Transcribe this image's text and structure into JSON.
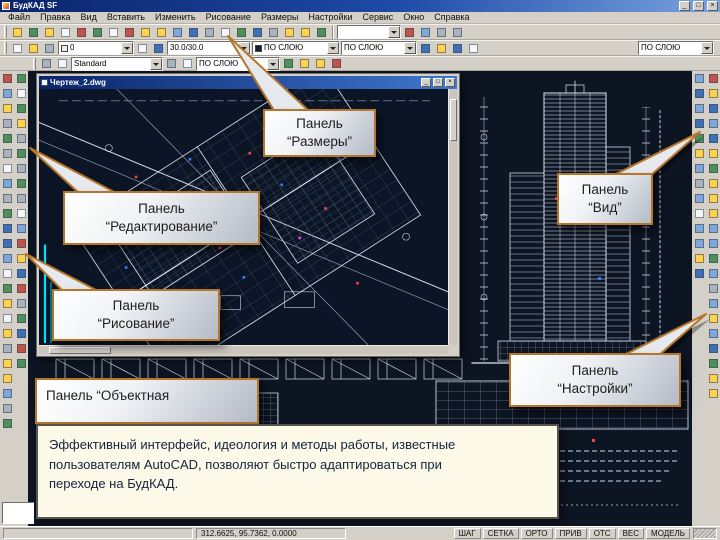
{
  "app": {
    "title": "БудКАД SF",
    "win_controls": {
      "min": "_",
      "max": "□",
      "close": "×"
    }
  },
  "menu": {
    "items": [
      {
        "label": "Файл",
        "name": "file"
      },
      {
        "label": "Правка",
        "name": "edit"
      },
      {
        "label": "Вид",
        "name": "view"
      },
      {
        "label": "Вставить",
        "name": "insert"
      },
      {
        "label": "Изменить",
        "name": "modify"
      },
      {
        "label": "Рисование",
        "name": "draw"
      },
      {
        "label": "Размеры",
        "name": "dimensions"
      },
      {
        "label": "Настройки",
        "name": "settings"
      },
      {
        "label": "Сервис",
        "name": "tools"
      },
      {
        "label": "Окно",
        "name": "window"
      },
      {
        "label": "Справка",
        "name": "help"
      }
    ]
  },
  "toolbars": {
    "row1_icons": [
      "new-file",
      "open-file",
      "save-file",
      "print",
      "print-preview",
      "spell-check",
      "cut",
      "copy",
      "paste",
      "match-properties",
      "undo",
      "redo",
      "insert-hyperlink",
      "ole-object",
      "pan-realtime",
      "zoom-realtime",
      "zoom-window",
      "zoom-previous",
      "properties",
      "help"
    ],
    "row1_combo": "",
    "row1_icons_b": [
      "redraw-view",
      "regen-view",
      "named-views",
      "3d-orbit"
    ],
    "row2_icons_a": [
      "layers-manager",
      "layer-states",
      "make-layer-current"
    ],
    "row2_icons_b": [
      "layer-previous",
      "layer-isolate"
    ],
    "row2_icons_c": [
      "linetype-manager",
      "lineweight-settings",
      "plot-style",
      "object-color"
    ],
    "row2_combos": [
      "0",
      "30.0/30.0",
      "ПО СЛОЮ",
      "ПО СЛОЮ"
    ],
    "row2_combo_right": "ПО СЛОЮ",
    "row3_icons_a": [
      "dim-linear",
      "dim-aligned"
    ],
    "row3_icons_b": [
      "dim-radius",
      "dim-angular"
    ],
    "row3_icons_c": [
      "dim-continue",
      "dim-baseline",
      "dim-style",
      "quick-dim"
    ],
    "row3_combos": [
      "Standard",
      "ПО СЛОЮ"
    ],
    "left_draw": [
      "line",
      "construction-line",
      "multiline",
      "polyline",
      "polygon",
      "rectangle",
      "arc",
      "circle",
      "revision-cloud",
      "spline",
      "ellipse",
      "ellipse-arc",
      "insert-block",
      "make-block",
      "point",
      "hatch",
      "gradient",
      "region",
      "table",
      "text-multiline",
      "text-single",
      "divide",
      "measure",
      "sketch"
    ],
    "left_modify": [
      "erase",
      "copy-object",
      "mirror",
      "offset",
      "array",
      "move",
      "rotate",
      "scale",
      "stretch",
      "lengthen",
      "trim",
      "extend",
      "break-at-point",
      "break",
      "join",
      "chamfer",
      "fillet",
      "explode",
      "edit-polyline",
      "edit-spline"
    ],
    "right_settings": [
      "snap-settings",
      "grid-settings",
      "osnap-settings",
      "polar-settings",
      "units-settings",
      "drawing-limits",
      "layer-properties",
      "linetype-settings",
      "text-style",
      "dimension-style",
      "point-style",
      "multiline-style",
      "options",
      "customize-ui"
    ],
    "right_view": [
      "zoom-window",
      "zoom-dynamic",
      "zoom-scale",
      "zoom-center",
      "zoom-object",
      "zoom-in",
      "zoom-out",
      "zoom-all",
      "zoom-extents",
      "pan-point",
      "aerial-view",
      "view-top",
      "view-bottom",
      "view-left",
      "view-right",
      "view-front",
      "view-back",
      "view-sw-iso",
      "view-se-iso",
      "view-ne-iso",
      "view-nw-iso",
      "3d-orbit"
    ]
  },
  "document_window": {
    "title": "Чертеж_2.dwg"
  },
  "callouts": {
    "dimensions": {
      "line1": "Панель",
      "line2": "“Размеры”"
    },
    "view": {
      "line1": "Панель",
      "line2": "“Вид”"
    },
    "editing": {
      "line1": "Панель",
      "line2": "“Редактирование”"
    },
    "drawing": {
      "line1": "Панель",
      "line2": "“Рисование”"
    },
    "object_snap": {
      "line1": "Панель “Объектная"
    },
    "settings": {
      "line1": "Панель",
      "line2": "“Настройки”"
    }
  },
  "infobox": {
    "lines": [
      "Эффективный интерфейс, идеология и методы работы, известные",
      "пользователям AutoCAD, позволяют быстро адаптироваться при",
      "переходе на БудКАД."
    ]
  },
  "statusbar": {
    "coords": "312.6625, 95.7362, 0.0000",
    "toggles": [
      {
        "label": "ШАГ",
        "name": "snap"
      },
      {
        "label": "СЕТКА",
        "name": "grid"
      },
      {
        "label": "ОРТО",
        "name": "ortho"
      },
      {
        "label": "ПРИВ",
        "name": "osnap"
      },
      {
        "label": "ОТС",
        "name": "otrack"
      },
      {
        "label": "ВЕС",
        "name": "lineweight"
      },
      {
        "label": "МОДЕЛЬ",
        "name": "model"
      }
    ]
  },
  "colors": {
    "titlebar": "#0a246a",
    "canvas_bg": "#0d1422",
    "callout_border": "#b5762a",
    "infobox_bg": "#fdf9e8",
    "cad_line": "#cdd9e6",
    "cad_cyan": "#00e0ff"
  }
}
